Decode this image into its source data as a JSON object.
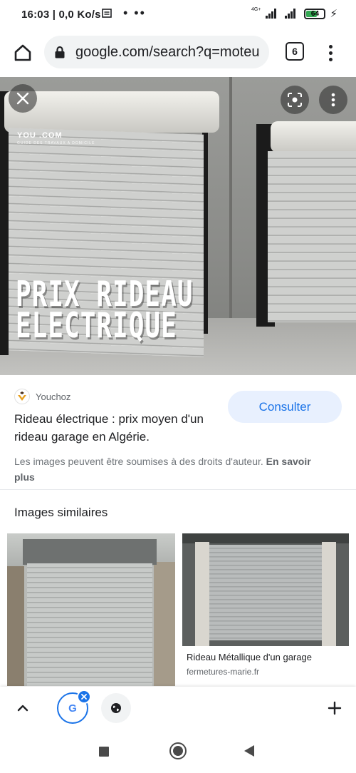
{
  "status_bar": {
    "time_speed": "16:03 | 0,0 Ko/s",
    "notification_dots": "• ••",
    "network_label": "4G+",
    "battery": "64",
    "battery_level": 0.64,
    "charging_icon": "⚡"
  },
  "browser": {
    "url": "google.com/search?q=moteu",
    "tab_count": "6"
  },
  "preview": {
    "overlay_line1": "PRIX RIDEAU",
    "overlay_line2": "ELECTRIQUE",
    "watermark": "YOU        .COM",
    "watermark_sub": "GUIDE DES TRAVAUX A DOMICILE"
  },
  "result": {
    "source": "Youchoz",
    "title": "Rideau électrique : prix moyen d'un rideau garage en Algérie.",
    "consult_label": "Consulter",
    "copyright_text": "Les images peuvent être soumises à des droits d'auteur.",
    "learn_more": "En savoir plus"
  },
  "similar": {
    "heading": "Images similaires",
    "items": [
      {
        "title": "",
        "source": ""
      },
      {
        "title": "Rideau Métallique d'un garage",
        "source": "fermetures-marie.fr"
      }
    ]
  },
  "toolbar": {
    "google_letter": "G"
  },
  "colors": {
    "accent": "#1a73e8",
    "consult_bg": "#e8f0fe",
    "battery_green": "#34a853"
  }
}
